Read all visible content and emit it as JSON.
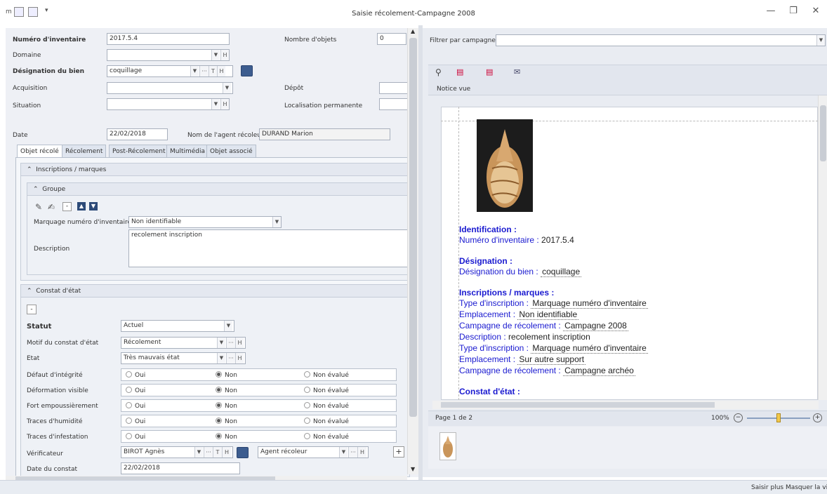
{
  "window": {
    "title": "Saisie récolement-Campagne 2008",
    "minimize": "—",
    "restore": "❐",
    "close": "✕"
  },
  "header": {
    "inv_label": "Numéro d'inventaire",
    "inv_value": "2017.5.4",
    "nbobj_label": "Nombre d'objets",
    "nbobj_value": "0",
    "domaine_label": "Domaine",
    "designation_label": "Désignation du bien",
    "designation_value": "coquillage",
    "acquisition_label": "Acquisition",
    "depot_label": "Dépôt",
    "situation_label": "Situation",
    "localisation_label": "Localisation permanente",
    "date_label": "Date",
    "date_value": "22/02/2018",
    "agent_label": "Nom de l'agent récoleur",
    "agent_value": "DURAND  Marion"
  },
  "tabs": [
    "Objet récolé",
    "Récolement",
    "Post-Récolement",
    "Multimédia",
    "Objet associé"
  ],
  "inscriptions": {
    "title": "Inscriptions / marques",
    "group_title": "Groupe",
    "marquage_label": "Marquage numéro d'inventaire",
    "marquage_value": "Non identifiable",
    "description_label": "Description",
    "description_value": "recolement inscription"
  },
  "constat": {
    "title": "Constat d'état",
    "minus": "-",
    "statut_label": "Statut",
    "statut_value": "Actuel",
    "motif_label": "Motif du constat d'état",
    "motif_value": "Récolement",
    "etat_label": "Etat",
    "etat_value": "Très mauvais état",
    "opt_oui": "Oui",
    "opt_non": "Non",
    "opt_nonevalue": "Non évalué",
    "rows": [
      "Défaut d'intégrité",
      "Déformation visible",
      "Fort empoussièrement",
      "Traces d'humidité",
      "Traces d'infestation"
    ],
    "verif_label": "Vérificateur",
    "verif_value": "BIROT  Agnès",
    "verif_role": "Agent récoleur",
    "date_constat_label": "Date du constat",
    "date_constat_value": "22/02/2018"
  },
  "right": {
    "filter_label": "Filtrer par campagne",
    "notice_tab": "Notice vue",
    "page_label": "Page 1 de 2",
    "zoom": "100%"
  },
  "doc": {
    "ident_h": "Identification :",
    "inv_l": "Numéro d'inventaire :",
    "inv_v": "2017.5.4",
    "desig_h": "Désignation :",
    "desig_l": "Désignation du bien :",
    "desig_v": "coquillage",
    "insc_h": "Inscriptions / marques :",
    "type_l": "Type d'inscription :",
    "type_v": "Marquage numéro d'inventaire",
    "empl_l": "Emplacement :",
    "empl_v1": "Non identifiable",
    "camp_l": "Campagne de récolement :",
    "camp_v1": "Campagne 2008",
    "desc_l": "Description :",
    "desc_v": "recolement inscription",
    "empl_v2": "Sur autre support",
    "camp_v2": "Campagne archéo",
    "constat_h": "Constat d'état :"
  },
  "status": {
    "text": "Saisir plus   Masquer la vi"
  }
}
